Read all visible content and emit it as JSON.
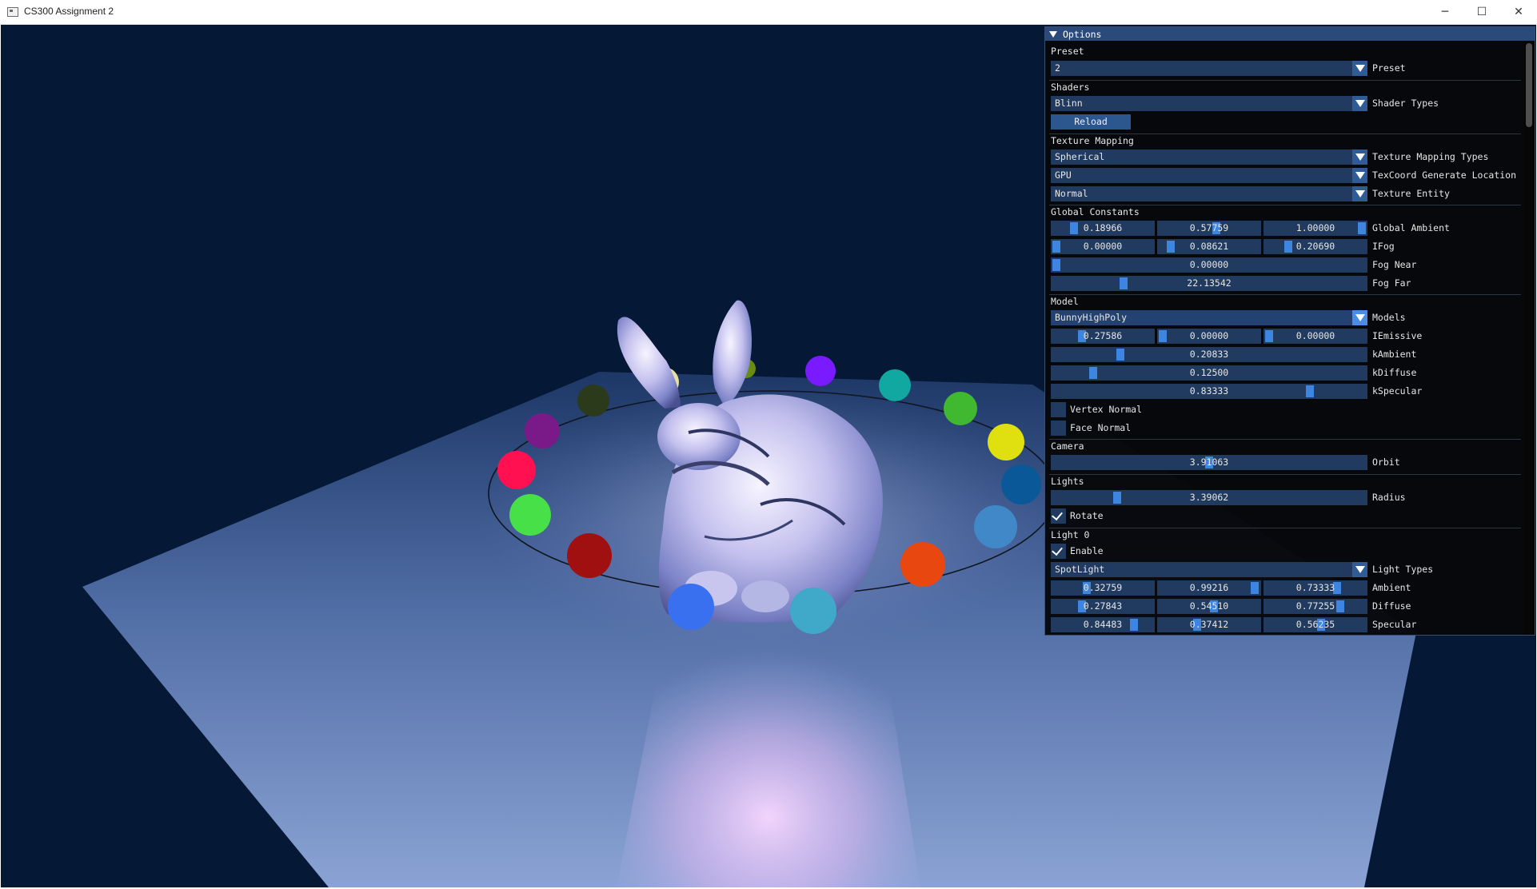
{
  "window": {
    "title": "CS300 Assignment 2",
    "minimize_glyph": "─",
    "maximize_glyph": "☐",
    "close_glyph": "✕"
  },
  "panel": {
    "title": "Options",
    "preset": {
      "section": "Preset",
      "value": "2",
      "label": "Preset"
    },
    "shaders": {
      "section": "Shaders",
      "value": "Blinn",
      "label": "Shader Types",
      "reload": "Reload"
    },
    "texture_mapping": {
      "section": "Texture Mapping",
      "type": {
        "value": "Spherical",
        "label": "Texture Mapping Types"
      },
      "location": {
        "value": "GPU",
        "label": "TexCoord Generate Location"
      },
      "entity": {
        "value": "Normal",
        "label": "Texture Entity"
      }
    },
    "global_constants": {
      "section": "Global Constants",
      "global_ambient": {
        "label": "Global Ambient",
        "values": [
          "0.18966",
          "0.57759",
          "1.00000"
        ],
        "fill": [
          0.19,
          0.58,
          1.0
        ]
      },
      "ifog": {
        "label": "IFog",
        "values": [
          "0.00000",
          "0.08621",
          "0.20690"
        ],
        "fill": [
          0.0,
          0.09,
          0.21
        ]
      },
      "fog_near": {
        "label": "Fog Near",
        "value": "0.00000",
        "fill": 0.0
      },
      "fog_far": {
        "label": "Fog Far",
        "value": "22.13542",
        "fill": 0.22
      }
    },
    "model": {
      "section": "Model",
      "model": {
        "value": "BunnyHighPoly",
        "label": "Models"
      },
      "iemissive": {
        "label": "IEmissive",
        "values": [
          "0.27586",
          "0.00000",
          "0.00000"
        ],
        "fill": [
          0.28,
          0.0,
          0.0
        ]
      },
      "kambient": {
        "label": "kAmbient",
        "value": "0.20833",
        "fill": 0.21
      },
      "kdiffuse": {
        "label": "kDiffuse",
        "value": "0.12500",
        "fill": 0.12
      },
      "kspecular": {
        "label": "kSpecular",
        "value": "0.83333",
        "fill": 0.83
      },
      "vertex_normal": {
        "label": "Vertex Normal",
        "checked": false
      },
      "face_normal": {
        "label": "Face Normal",
        "checked": false
      }
    },
    "camera": {
      "section": "Camera",
      "orbit": {
        "label": "Orbit",
        "value": "3.91063",
        "fill": 0.5
      }
    },
    "lights": {
      "section": "Lights",
      "radius": {
        "label": "Radius",
        "value": "3.39062",
        "fill": 0.2
      },
      "rotate": {
        "label": "Rotate",
        "checked": true
      }
    },
    "light0": {
      "section": "Light 0",
      "enable": {
        "label": "Enable",
        "checked": true
      },
      "type": {
        "value": "SpotLight",
        "label": "Light Types"
      },
      "ambient": {
        "label": "Ambient",
        "values": [
          "0.32759",
          "0.99216",
          "0.73333"
        ],
        "fill": [
          0.33,
          0.99,
          0.73
        ]
      },
      "diffuse": {
        "label": "Diffuse",
        "values": [
          "0.27843",
          "0.54510",
          "0.77255"
        ],
        "fill": [
          0.28,
          0.55,
          0.77
        ]
      },
      "specular": {
        "label": "Specular",
        "values": [
          "0.84483",
          "0.37412",
          "0.56235"
        ],
        "fill": [
          0.84,
          0.37,
          0.56
        ]
      }
    }
  },
  "scene": {
    "background_color": "#051937",
    "orbit_lights": [
      {
        "color": "#2a3a1a"
      },
      {
        "color": "#e8e0a0"
      },
      {
        "color": "#6a8a10"
      },
      {
        "color": "#7a1aff"
      },
      {
        "color": "#10a8a0"
      },
      {
        "color": "#40b830"
      },
      {
        "color": "#e0e010"
      },
      {
        "color": "#0a5898"
      },
      {
        "color": "#4088c8"
      },
      {
        "color": "#e84810"
      },
      {
        "color": "#40a8c8"
      },
      {
        "color": "#3870f0"
      },
      {
        "color": "#a01010"
      },
      {
        "color": "#48e048"
      },
      {
        "color": "#ff1050"
      },
      {
        "color": "#7a1a88"
      }
    ]
  }
}
